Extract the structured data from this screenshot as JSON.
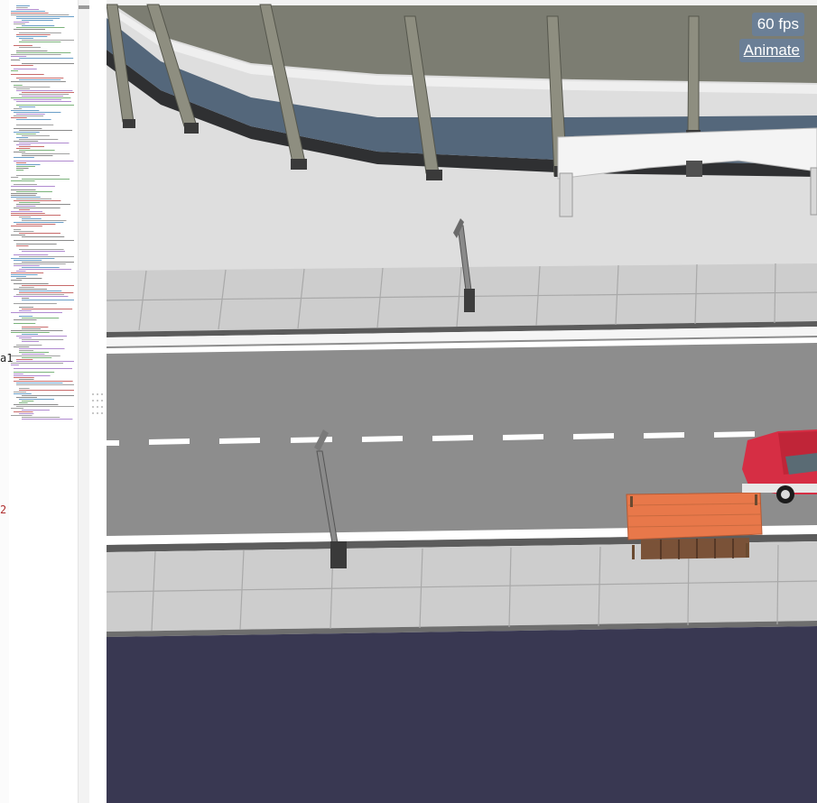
{
  "editor": {
    "cut_labels": [
      "a1",
      "2"
    ]
  },
  "viewport": {
    "fps_label": "60 fps",
    "animate_label": "Animate"
  },
  "scene_colors": {
    "ground": "#dedede",
    "stadium_wall": "#7c7d72",
    "stadium_band": "#54677b",
    "sidewalk": "#cbcbcb",
    "road": "#8d8d8d",
    "lane_marking": "#ffffff",
    "water": "#393852",
    "bench_top": "#e8784a",
    "bench_slats": "#7a5238",
    "car": "#d62e44"
  }
}
